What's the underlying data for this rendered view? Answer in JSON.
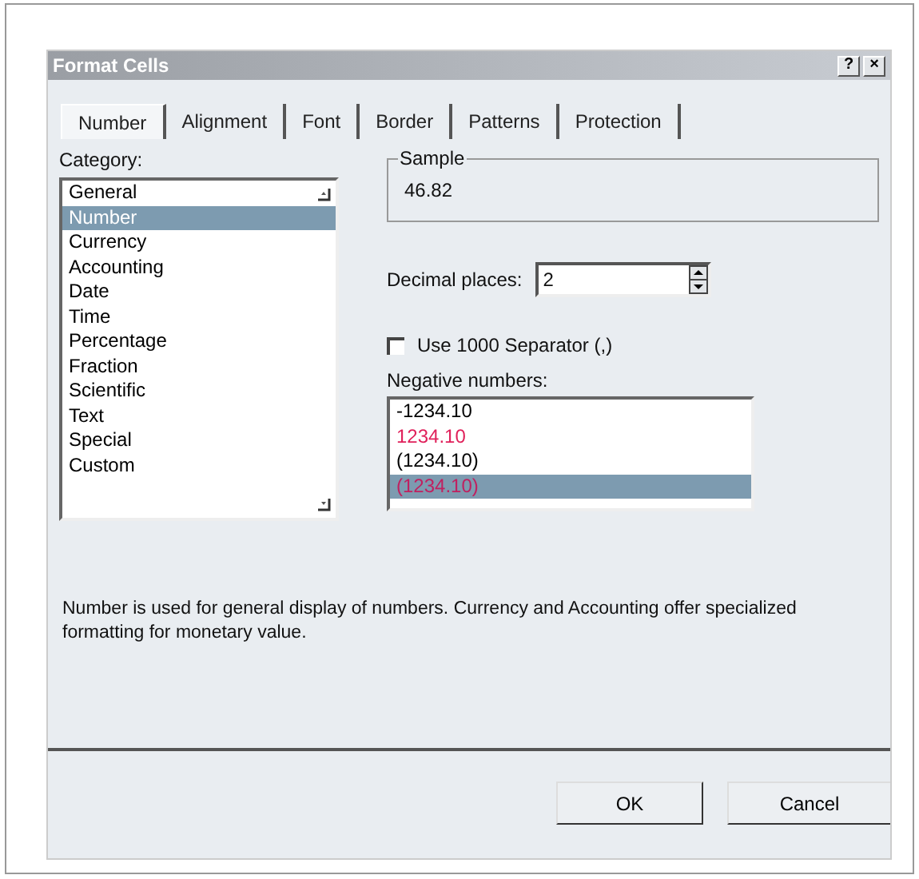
{
  "window": {
    "title": "Format Cells",
    "help_button": "?",
    "close_button": "×"
  },
  "tabs": [
    {
      "label": "Number",
      "selected": true
    },
    {
      "label": "Alignment",
      "selected": false
    },
    {
      "label": "Font",
      "selected": false
    },
    {
      "label": "Border",
      "selected": false
    },
    {
      "label": "Patterns",
      "selected": false
    },
    {
      "label": "Protection",
      "selected": false
    }
  ],
  "category": {
    "label": "Category:",
    "items": [
      {
        "label": "General",
        "selected": false
      },
      {
        "label": "Number",
        "selected": true
      },
      {
        "label": "Currency",
        "selected": false
      },
      {
        "label": "Accounting",
        "selected": false
      },
      {
        "label": "Date",
        "selected": false
      },
      {
        "label": "Time",
        "selected": false
      },
      {
        "label": "Percentage",
        "selected": false
      },
      {
        "label": "Fraction",
        "selected": false
      },
      {
        "label": "Scientific",
        "selected": false
      },
      {
        "label": "Text",
        "selected": false
      },
      {
        "label": "Special",
        "selected": false
      },
      {
        "label": "Custom",
        "selected": false
      }
    ]
  },
  "sample": {
    "label": "Sample",
    "value": "46.82"
  },
  "decimal_places": {
    "label": "Decimal places:",
    "value": "2"
  },
  "separator": {
    "label": "Use 1000 Separator (,)",
    "checked": false
  },
  "negative_numbers": {
    "label": "Negative numbers:",
    "items": [
      {
        "label": "-1234.10",
        "color": "#000000",
        "selected": false
      },
      {
        "label": "1234.10",
        "color": "#e0205a",
        "selected": false
      },
      {
        "label": "(1234.10)",
        "color": "#000000",
        "selected": false
      },
      {
        "label": "(1234.10)",
        "color": "#c02060",
        "selected": true
      }
    ]
  },
  "description": "Number is used for general display of numbers.  Currency and Accounting offer specialized formatting for monetary value.",
  "buttons": [
    "OK",
    "Cancel"
  ]
}
